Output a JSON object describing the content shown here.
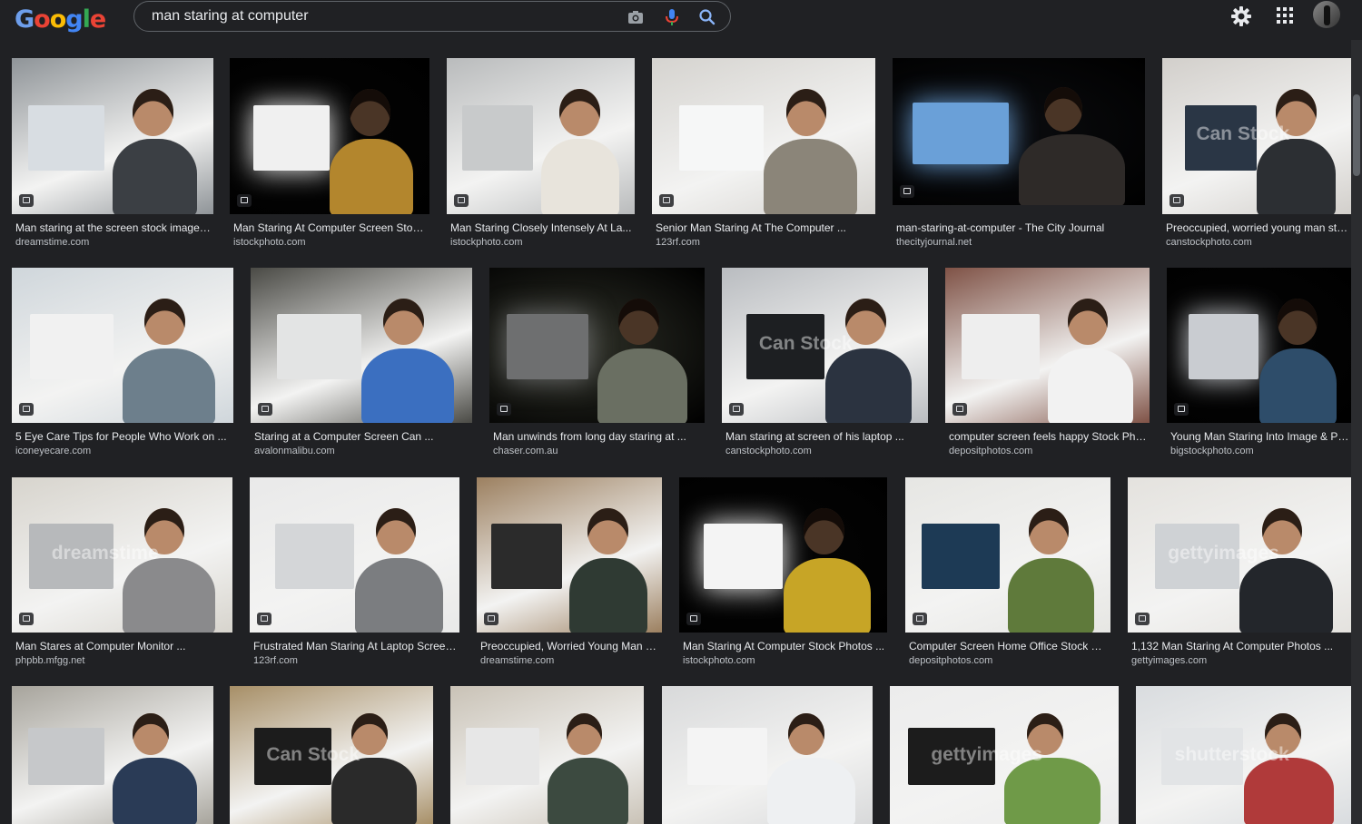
{
  "header": {
    "query": "man staring at computer"
  },
  "results": [
    {
      "title": "Man staring at the screen stock image ...",
      "source": "dreamstime.com",
      "watermark": ""
    },
    {
      "title": "Man Staring At Computer Screen Stock...",
      "source": "istockphoto.com",
      "watermark": ""
    },
    {
      "title": "Man Staring Closely Intensely At La...",
      "source": "istockphoto.com",
      "watermark": ""
    },
    {
      "title": "Senior Man Staring At The Computer ...",
      "source": "123rf.com",
      "watermark": ""
    },
    {
      "title": "man-staring-at-computer - The City Journal",
      "source": "thecityjournal.net",
      "watermark": ""
    },
    {
      "title": "Preoccupied, worried young man sta...",
      "source": "canstockphoto.com",
      "watermark": "Can Stock"
    },
    {
      "title": "5 Eye Care Tips for People Who Work on ...",
      "source": "iconeyecare.com",
      "watermark": ""
    },
    {
      "title": "Staring at a Computer Screen Can ...",
      "source": "avalonmalibu.com",
      "watermark": ""
    },
    {
      "title": "Man unwinds from long day staring at ...",
      "source": "chaser.com.au",
      "watermark": ""
    },
    {
      "title": "Man staring at screen of his laptop ...",
      "source": "canstockphoto.com",
      "watermark": "Can Stock"
    },
    {
      "title": "computer screen feels happy Stock Pho...",
      "source": "depositphotos.com",
      "watermark": ""
    },
    {
      "title": "Young Man Staring Into Image & Ph...",
      "source": "bigstockphoto.com",
      "watermark": ""
    },
    {
      "title": "Man Stares at Computer Monitor ...",
      "source": "phpbb.mfgg.net",
      "watermark": "dreamstime"
    },
    {
      "title": "Frustrated Man Staring At Laptop Screen...",
      "source": "123rf.com",
      "watermark": ""
    },
    {
      "title": "Preoccupied, Worried Young Man S...",
      "source": "dreamstime.com",
      "watermark": ""
    },
    {
      "title": "Man Staring At Computer Stock Photos ...",
      "source": "istockphoto.com",
      "watermark": ""
    },
    {
      "title": "Computer Screen Home Office Stock Ph...",
      "source": "depositphotos.com",
      "watermark": ""
    },
    {
      "title": "1,132 Man Staring At Computer Photos ...",
      "source": "gettyimages.com",
      "watermark": "gettyimages"
    },
    {
      "title": "",
      "source": "",
      "watermark": ""
    },
    {
      "title": "",
      "source": "",
      "watermark": "Can Stock"
    },
    {
      "title": "",
      "source": "",
      "watermark": ""
    },
    {
      "title": "",
      "source": "",
      "watermark": ""
    },
    {
      "title": "",
      "source": "",
      "watermark": "gettyimages"
    },
    {
      "title": "",
      "source": "",
      "watermark": "shutterstock"
    }
  ],
  "colors": {
    "background": "#202124",
    "caption": "#e8eaed",
    "source": "#bdc1c6"
  }
}
